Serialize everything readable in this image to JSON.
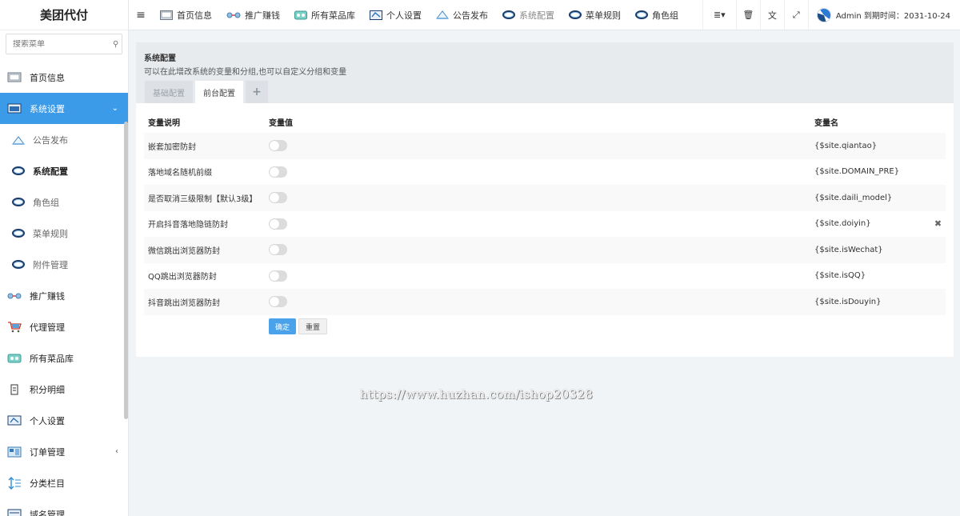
{
  "app": {
    "title": "美团代付"
  },
  "search": {
    "placeholder": "搜索菜单"
  },
  "sidebar": {
    "items": [
      {
        "label": "首页信息",
        "icon": "home-screen-icon"
      },
      {
        "label": "系统设置",
        "icon": "settings-screen-icon",
        "arrow": "⌄"
      },
      {
        "label": "推广赚钱",
        "icon": "promote-icon"
      },
      {
        "label": "代理管理",
        "icon": "cart-icon"
      },
      {
        "label": "所有菜品库",
        "icon": "dish-library-icon"
      },
      {
        "label": "积分明细",
        "icon": "points-icon"
      },
      {
        "label": "个人设置",
        "icon": "personal-screen-icon"
      },
      {
        "label": "订单管理",
        "icon": "order-icon",
        "arrow": "‹"
      },
      {
        "label": "分类栏目",
        "icon": "category-arrows-icon"
      },
      {
        "label": "域名管理",
        "icon": "domain-icon"
      }
    ],
    "subitems": [
      {
        "label": "公告发布",
        "icon": "announcement-icon"
      },
      {
        "label": "系统配置",
        "icon": "ring-icon"
      },
      {
        "label": "角色组",
        "icon": "ring-icon"
      },
      {
        "label": "菜单规则",
        "icon": "ring-icon"
      },
      {
        "label": "附件管理",
        "icon": "ring-icon"
      }
    ]
  },
  "topbar": {
    "toggle": "≡",
    "tabs": [
      {
        "label": "首页信息",
        "icon": "home-screen-icon"
      },
      {
        "label": "推广赚钱",
        "icon": "promote-icon"
      },
      {
        "label": "所有菜品库",
        "icon": "dish-library-icon"
      },
      {
        "label": "个人设置",
        "icon": "personal-screen-icon"
      },
      {
        "label": "公告发布",
        "icon": "announcement-icon"
      },
      {
        "label": "系统配置",
        "icon": "ring-icon"
      },
      {
        "label": "菜单规则",
        "icon": "ring-icon"
      },
      {
        "label": "角色组",
        "icon": "ring-icon"
      }
    ],
    "more": "≣▾",
    "trash": "🗑",
    "lang": "文",
    "fullscreen": "⤢",
    "user": "Admin 到期时间：2031-10-24"
  },
  "panel": {
    "title": "系统配置",
    "desc": "可以在此增改系统的变量和分组,也可以自定义分组和变量",
    "tabs": [
      "基础配置",
      "前台配置",
      "+"
    ]
  },
  "table": {
    "headers": [
      "变量说明",
      "变量值",
      "变量名"
    ],
    "rows": [
      {
        "desc": "嵌套加密防封",
        "name": "{$site.qiantao}"
      },
      {
        "desc": "落地域名随机前缀",
        "name": "{$site.DOMAIN_PRE}"
      },
      {
        "desc": "是否取消三级限制【默认3级】",
        "name": "{$site.daili_model}"
      },
      {
        "desc": "开启抖音落地隐链防封",
        "name": "{$site.doiyin}",
        "delete": "✖"
      },
      {
        "desc": "微信跳出浏览器防封",
        "name": "{$site.isWechat}"
      },
      {
        "desc": "QQ跳出浏览器防封",
        "name": "{$site.isQQ}"
      },
      {
        "desc": "抖音跳出浏览器防封",
        "name": "{$site.isDouyin}"
      }
    ]
  },
  "buttons": {
    "confirm": "确定",
    "reset": "重置"
  },
  "watermark": "https://www.huzhan.com/ishop20328",
  "colors": {
    "accent": "#3c9be8",
    "primary_button": "#4aa3ea"
  }
}
